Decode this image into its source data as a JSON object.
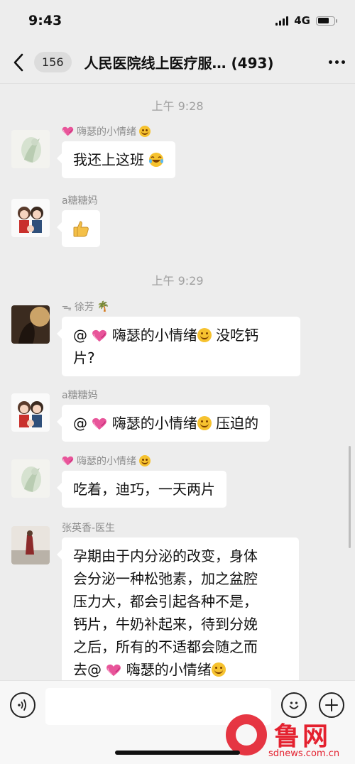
{
  "status": {
    "time": "9:43",
    "network": "4G",
    "battery_level": 0.7
  },
  "nav": {
    "unread_count": "156",
    "title": "人民医院线上医疗服…",
    "member_count": "(493)"
  },
  "timestamps": [
    "上午 9:28",
    "上午 9:29"
  ],
  "messages": [
    {
      "sender": "嗨瑟的小情绪",
      "text": "我还上这班",
      "emoji": "laughing-tears"
    },
    {
      "sender": "a糖糖妈",
      "emoji": "thumbs-up"
    },
    {
      "sender_prefix": "ᯓ",
      "sender": "徐芳",
      "sender_suffix": "🌴",
      "mention": "@",
      "mention_name": "嗨瑟的小情绪",
      "text_line1": "没吃钙",
      "text_line2": "片?"
    },
    {
      "sender": "a糖糖妈",
      "mention": "@",
      "mention_name": "嗨瑟的小情绪",
      "text": "压迫的"
    },
    {
      "sender": "嗨瑟的小情绪",
      "text": "吃着，迪巧，一天两片"
    },
    {
      "sender": "张英香-医生",
      "lines": [
        "孕期由于内分泌的改变，身体",
        "会分泌一种松弛素，加之盆腔",
        "压力大，都会引起各种不是，",
        "钙片，牛奶补起来，待到分娩",
        "之后，所有的不适都会随之而"
      ],
      "last_line_prefix": "去@",
      "mention_name": "嗨瑟的小情绪"
    }
  ],
  "input": {
    "placeholder": ""
  },
  "watermark": {
    "title": "鲁网",
    "url": "sdnews.com.cn"
  },
  "colors": {
    "background": "#ededed",
    "bubble": "#ffffff",
    "accent": "#e4212f"
  }
}
